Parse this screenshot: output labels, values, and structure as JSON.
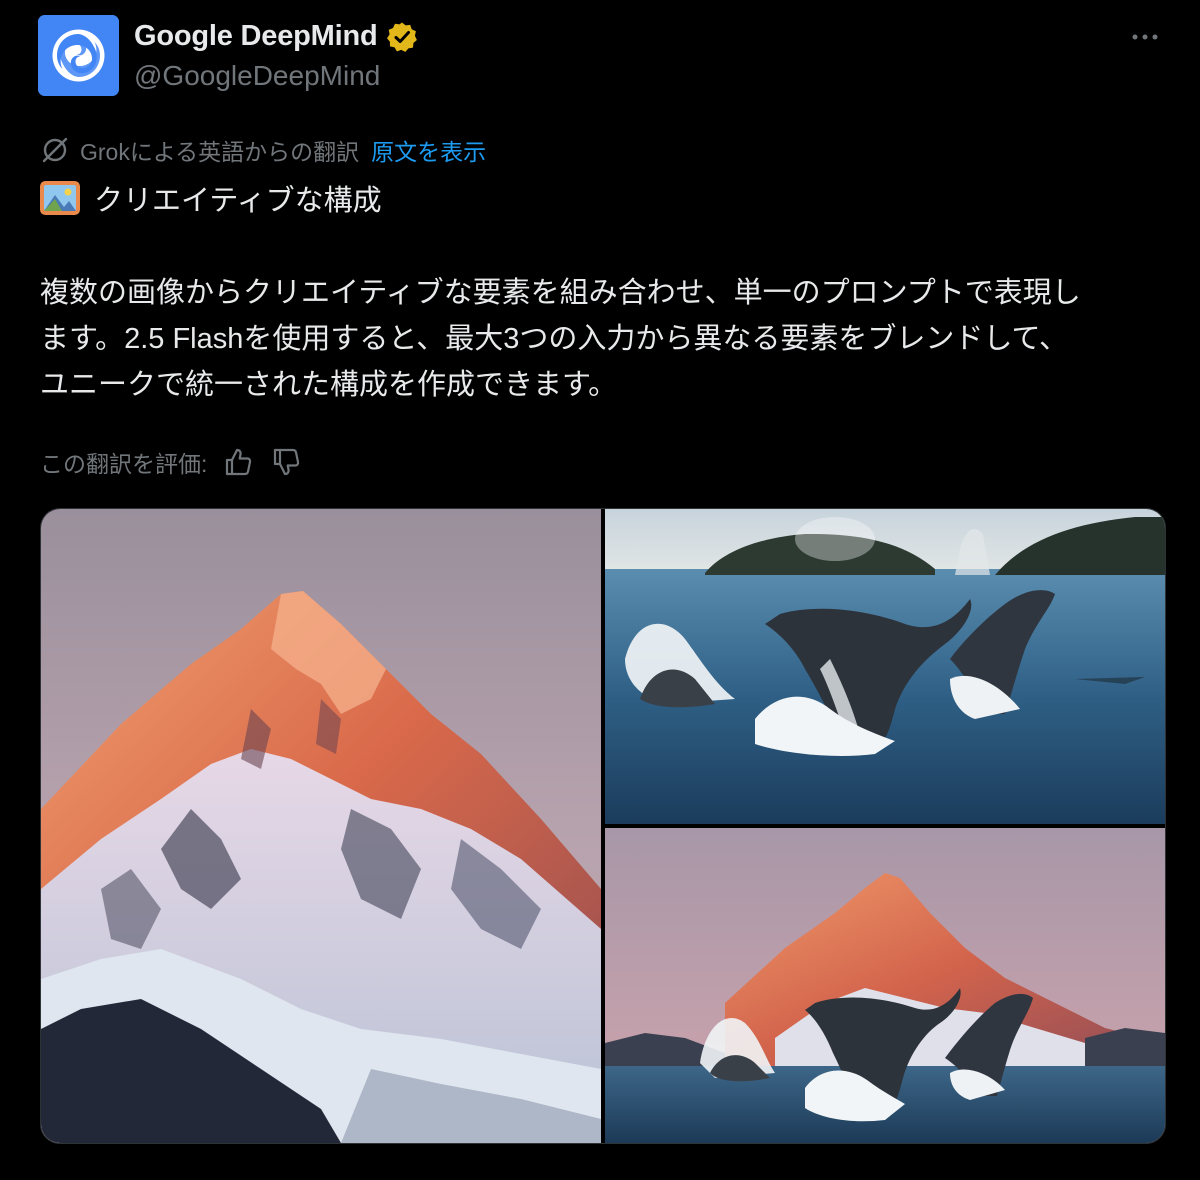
{
  "post": {
    "author": {
      "display_name": "Google DeepMind",
      "handle": "@GoogleDeepMind",
      "avatar_icon": "deepmind-logo",
      "avatar_color": "#4285f4",
      "verified": true,
      "verified_badge_color": "#e2b719"
    },
    "more_icon": "more-horizontal-icon",
    "translation": {
      "icon": "grok-icon",
      "label": "Grokによる英語からの翻訳",
      "show_original_link": "原文を表示"
    },
    "title_emoji": "framed-picture-emoji",
    "title": "クリエイティブな構成",
    "body_lines": [
      "複数の画像からクリエイティブな要素を組み合わせ、単一のプロンプトで表現し",
      "ます。2.5 Flashを使用すると、最大3つの入力から異なる要素をブレンドして、",
      "ユニークで統一された構成を作成できます。"
    ],
    "rating": {
      "label": "この翻訳を評価:",
      "thumbs_up_icon": "thumbs-up-icon",
      "thumbs_down_icon": "thumbs-down-icon"
    },
    "media": [
      {
        "position": "left",
        "subject": "snow-covered mountain peak at sunset"
      },
      {
        "position": "top-right",
        "subject": "humpback whales breaching near forested islands"
      },
      {
        "position": "bottom-right",
        "subject": "humpback whales breaching in front of mountain peak"
      }
    ]
  },
  "colors": {
    "background": "#000000",
    "text_primary": "#e7e9ea",
    "text_secondary": "#71767b",
    "link": "#1d9bf0"
  }
}
